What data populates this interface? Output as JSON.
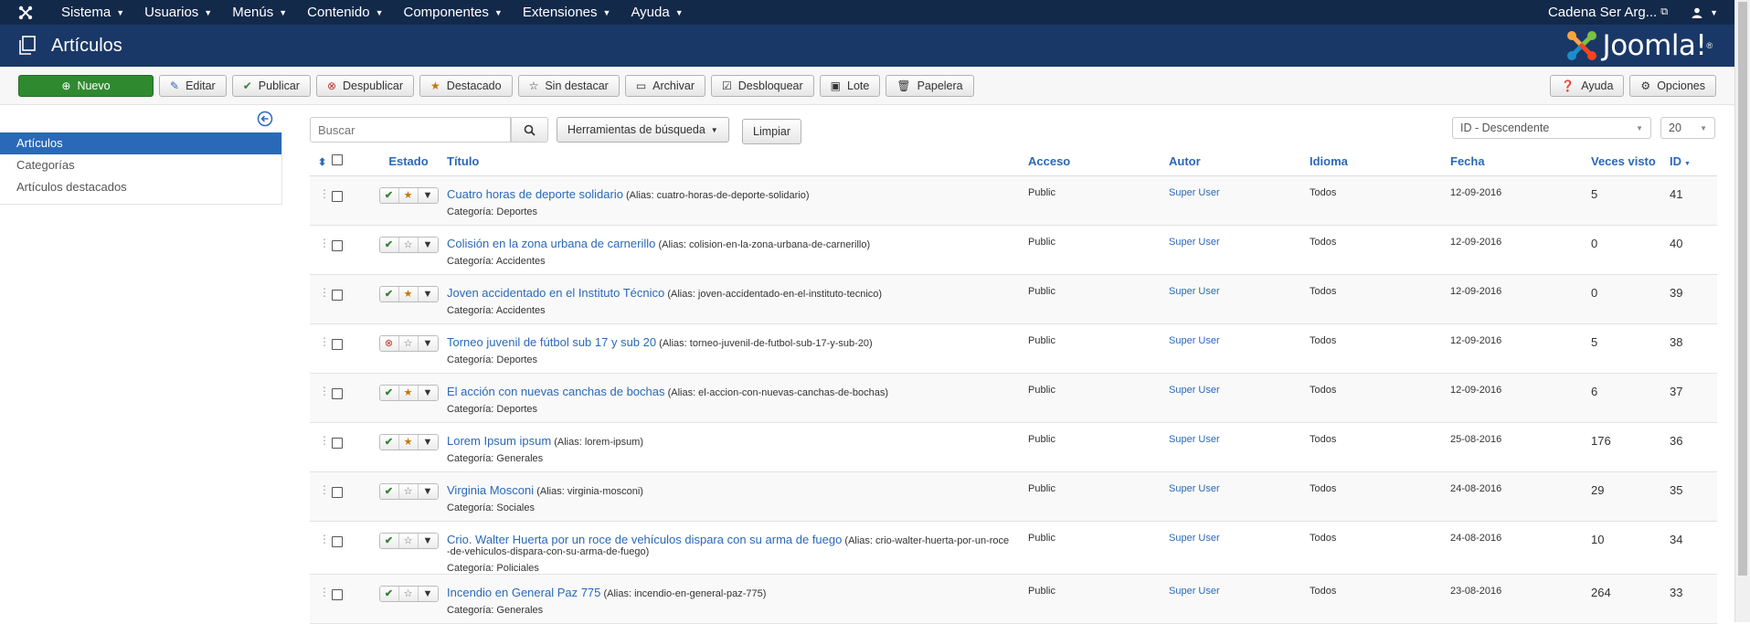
{
  "topnav": {
    "menus": [
      "Sistema",
      "Usuarios",
      "Menús",
      "Contenido",
      "Componentes",
      "Extensiones",
      "Ayuda"
    ],
    "site_name": "Cadena Ser Arg..."
  },
  "header": {
    "title": "Artículos",
    "brand": "Joomla!"
  },
  "toolbar": {
    "new": "Nuevo",
    "edit": "Editar",
    "publish": "Publicar",
    "unpublish": "Despublicar",
    "feature": "Destacado",
    "unfeature": "Sin destacar",
    "archive": "Archivar",
    "checkin": "Desbloquear",
    "batch": "Lote",
    "trash": "Papelera",
    "help": "Ayuda",
    "options": "Opciones"
  },
  "sidebar": {
    "items": [
      {
        "label": "Artículos",
        "active": true
      },
      {
        "label": "Categorías",
        "active": false
      },
      {
        "label": "Artículos destacados",
        "active": false
      }
    ]
  },
  "filters": {
    "search_placeholder": "Buscar",
    "tools_label": "Herramientas de búsqueda",
    "clear_label": "Limpiar",
    "sort_value": "ID - Descendente",
    "limit_value": "20"
  },
  "table": {
    "headers": {
      "estado": "Estado",
      "titulo": "Título",
      "acceso": "Acceso",
      "autor": "Autor",
      "idioma": "Idioma",
      "fecha": "Fecha",
      "visto": "Veces visto",
      "id": "ID"
    },
    "rows": [
      {
        "title": "Cuatro horas de deporte solidario",
        "alias": "(Alias: cuatro-horas-de-deporte-solidario)",
        "alias2": "",
        "category": "Categoría: Deportes",
        "published": true,
        "featured": true,
        "access": "Public",
        "author": "Super User",
        "language": "Todos",
        "date": "12-09-2016",
        "hits": "5",
        "id": "41"
      },
      {
        "title": "Colisión en la zona urbana de carnerillo",
        "alias": "(Alias: colision-en-la-zona-urbana-de-carnerillo)",
        "alias2": "",
        "category": "Categoría: Accidentes",
        "published": true,
        "featured": false,
        "access": "Public",
        "author": "Super User",
        "language": "Todos",
        "date": "12-09-2016",
        "hits": "0",
        "id": "40"
      },
      {
        "title": "Joven accidentado en el Instituto Técnico",
        "alias": "(Alias: joven-accidentado-en-el-instituto-tecnico)",
        "alias2": "",
        "category": "Categoría: Accidentes",
        "published": true,
        "featured": true,
        "access": "Public",
        "author": "Super User",
        "language": "Todos",
        "date": "12-09-2016",
        "hits": "0",
        "id": "39"
      },
      {
        "title": "Torneo juvenil de fútbol sub 17 y sub 20",
        "alias": "(Alias: torneo-juvenil-de-futbol-sub-17-y-sub-20)",
        "alias2": "",
        "category": "Categoría: Deportes",
        "published": false,
        "featured": false,
        "access": "Public",
        "author": "Super User",
        "language": "Todos",
        "date": "12-09-2016",
        "hits": "5",
        "id": "38"
      },
      {
        "title": "El acción con nuevas canchas de bochas",
        "alias": "(Alias: el-accion-con-nuevas-canchas-de-bochas)",
        "alias2": "",
        "category": "Categoría: Deportes",
        "published": true,
        "featured": true,
        "access": "Public",
        "author": "Super User",
        "language": "Todos",
        "date": "12-09-2016",
        "hits": "6",
        "id": "37"
      },
      {
        "title": "Lorem Ipsum ipsum",
        "alias": "(Alias: lorem-ipsum)",
        "alias2": "",
        "category": "Categoría: Generales",
        "published": true,
        "featured": true,
        "access": "Public",
        "author": "Super User",
        "language": "Todos",
        "date": "25-08-2016",
        "hits": "176",
        "id": "36"
      },
      {
        "title": "Virginia Mosconi",
        "alias": "(Alias: virginia-mosconi)",
        "alias2": "",
        "category": "Categoría: Sociales",
        "published": true,
        "featured": false,
        "access": "Public",
        "author": "Super User",
        "language": "Todos",
        "date": "24-08-2016",
        "hits": "29",
        "id": "35"
      },
      {
        "title": "Crio. Walter Huerta por un roce de vehículos dispara con su arma de fuego",
        "alias": "(Alias: crio-walter-huerta-por-un-roce",
        "alias2": "-de-vehiculos-dispara-con-su-arma-de-fuego)",
        "category": "Categoría: Policiales",
        "published": true,
        "featured": false,
        "access": "Public",
        "author": "Super User",
        "language": "Todos",
        "date": "24-08-2016",
        "hits": "10",
        "id": "34"
      },
      {
        "title": "Incendio en General Paz 775",
        "alias": "(Alias: incendio-en-general-paz-775)",
        "alias2": "",
        "category": "Categoría: Generales",
        "published": true,
        "featured": false,
        "access": "Public",
        "author": "Super User",
        "language": "Todos",
        "date": "23-08-2016",
        "hits": "264",
        "id": "33"
      }
    ]
  }
}
